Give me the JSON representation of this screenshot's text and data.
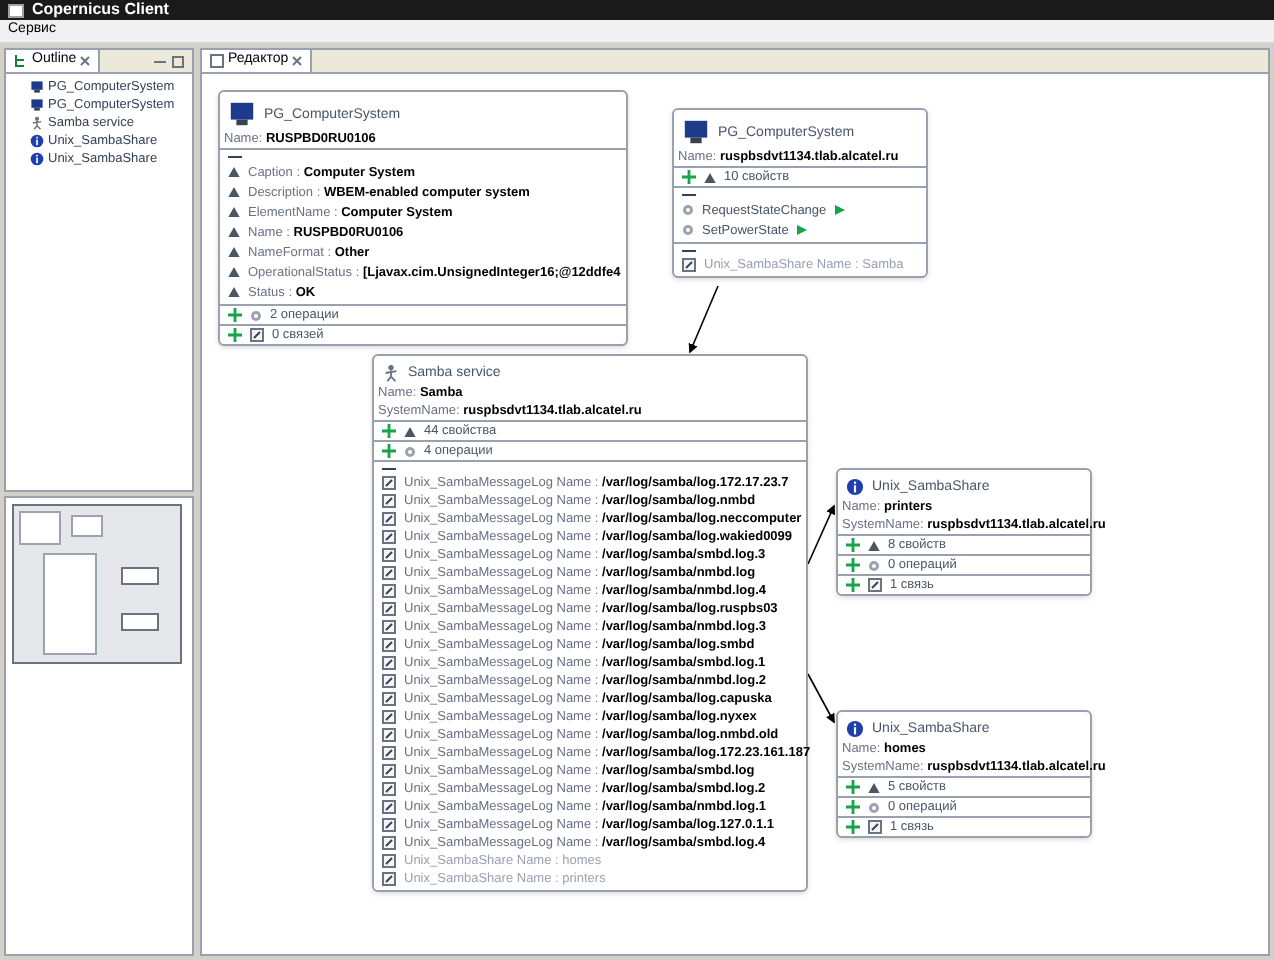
{
  "window": {
    "title": "Copernicus Client"
  },
  "menu": [
    "Сервис"
  ],
  "outline": {
    "tab": "Outline",
    "items": [
      {
        "kind": "computer",
        "label": "PG_ComputerSystem"
      },
      {
        "kind": "computer",
        "label": "PG_ComputerSystem"
      },
      {
        "kind": "service",
        "label": "Samba service"
      },
      {
        "kind": "share",
        "label": "Unix_SambaShare"
      },
      {
        "kind": "share",
        "label": "Unix_SambaShare"
      }
    ]
  },
  "editor": {
    "tab": "Редактор"
  },
  "nodes": [
    {
      "kind": "computer",
      "title": "PG_ComputerSystem",
      "fields": [
        {
          "label": "Name:",
          "value": "RUSPBD0RU0106"
        }
      ],
      "sections": [
        {
          "kind": "properties",
          "expanded": true,
          "items": [
            {
              "label": "Caption :",
              "value": "Computer System"
            },
            {
              "label": "Description :",
              "value": "WBEM-enabled computer system"
            },
            {
              "label": "ElementName :",
              "value": "Computer System"
            },
            {
              "label": "Name :",
              "value": "RUSPBD0RU0106"
            },
            {
              "label": "NameFormat :",
              "value": "Other"
            },
            {
              "label": "OperationalStatus :",
              "value": "[Ljavax.cim.UnsignedInteger16;@12ddfe4"
            },
            {
              "label": "Status :",
              "value": "OK"
            }
          ]
        },
        {
          "kind": "operations",
          "expanded": false,
          "label": "2 операции"
        },
        {
          "kind": "links",
          "expanded": false,
          "label": "0 связей"
        }
      ]
    },
    {
      "kind": "computer",
      "title": "PG_ComputerSystem",
      "fields": [
        {
          "label": "Name:",
          "value": "ruspbsdvt1134.tlab.alcatel.ru"
        }
      ],
      "sections": [
        {
          "kind": "properties",
          "expanded": false,
          "label": "10 свойств"
        },
        {
          "kind": "operations",
          "expanded": true,
          "items": [
            {
              "label": "RequestStateChange"
            },
            {
              "label": "SetPowerState"
            }
          ]
        },
        {
          "kind": "links",
          "expanded": true,
          "items": [
            {
              "type": "Unix_SambaShare",
              "label": "Name :",
              "value": "Samba",
              "faded": true
            }
          ]
        }
      ]
    },
    {
      "kind": "service",
      "title": "Samba service",
      "fields": [
        {
          "label": "Name:",
          "value": "Samba"
        },
        {
          "label": "SystemName:",
          "value": "ruspbsdvt1134.tlab.alcatel.ru"
        }
      ],
      "sections": [
        {
          "kind": "properties",
          "expanded": false,
          "label": "44 свойства"
        },
        {
          "kind": "operations",
          "expanded": false,
          "label": "4 операции"
        },
        {
          "kind": "links",
          "expanded": true,
          "items": [
            {
              "type": "Unix_SambaMessageLog",
              "label": "Name :",
              "value": "/var/log/samba/log.172.17.23.7",
              "faded": false
            },
            {
              "type": "Unix_SambaMessageLog",
              "label": "Name :",
              "value": "/var/log/samba/log.nmbd",
              "faded": false
            },
            {
              "type": "Unix_SambaMessageLog",
              "label": "Name :",
              "value": "/var/log/samba/log.neccomputer",
              "faded": false
            },
            {
              "type": "Unix_SambaMessageLog",
              "label": "Name :",
              "value": "/var/log/samba/log.wakied0099",
              "faded": false
            },
            {
              "type": "Unix_SambaMessageLog",
              "label": "Name :",
              "value": "/var/log/samba/smbd.log.3",
              "faded": false
            },
            {
              "type": "Unix_SambaMessageLog",
              "label": "Name :",
              "value": "/var/log/samba/nmbd.log",
              "faded": false
            },
            {
              "type": "Unix_SambaMessageLog",
              "label": "Name :",
              "value": "/var/log/samba/nmbd.log.4",
              "faded": false
            },
            {
              "type": "Unix_SambaMessageLog",
              "label": "Name :",
              "value": "/var/log/samba/log.ruspbs03",
              "faded": false
            },
            {
              "type": "Unix_SambaMessageLog",
              "label": "Name :",
              "value": "/var/log/samba/nmbd.log.3",
              "faded": false
            },
            {
              "type": "Unix_SambaMessageLog",
              "label": "Name :",
              "value": "/var/log/samba/log.smbd",
              "faded": false
            },
            {
              "type": "Unix_SambaMessageLog",
              "label": "Name :",
              "value": "/var/log/samba/smbd.log.1",
              "faded": false
            },
            {
              "type": "Unix_SambaMessageLog",
              "label": "Name :",
              "value": "/var/log/samba/nmbd.log.2",
              "faded": false
            },
            {
              "type": "Unix_SambaMessageLog",
              "label": "Name :",
              "value": "/var/log/samba/log.capuska",
              "faded": false
            },
            {
              "type": "Unix_SambaMessageLog",
              "label": "Name :",
              "value": "/var/log/samba/log.nyxex",
              "faded": false
            },
            {
              "type": "Unix_SambaMessageLog",
              "label": "Name :",
              "value": "/var/log/samba/log.nmbd.old",
              "faded": false
            },
            {
              "type": "Unix_SambaMessageLog",
              "label": "Name :",
              "value": "/var/log/samba/log.172.23.161.187",
              "faded": false
            },
            {
              "type": "Unix_SambaMessageLog",
              "label": "Name :",
              "value": "/var/log/samba/smbd.log",
              "faded": false
            },
            {
              "type": "Unix_SambaMessageLog",
              "label": "Name :",
              "value": "/var/log/samba/smbd.log.2",
              "faded": false
            },
            {
              "type": "Unix_SambaMessageLog",
              "label": "Name :",
              "value": "/var/log/samba/nmbd.log.1",
              "faded": false
            },
            {
              "type": "Unix_SambaMessageLog",
              "label": "Name :",
              "value": "/var/log/samba/log.127.0.1.1",
              "faded": false
            },
            {
              "type": "Unix_SambaMessageLog",
              "label": "Name :",
              "value": "/var/log/samba/smbd.log.4",
              "faded": false
            },
            {
              "type": "Unix_SambaShare",
              "label": "Name :",
              "value": "homes",
              "faded": true
            },
            {
              "type": "Unix_SambaShare",
              "label": "Name :",
              "value": "printers",
              "faded": true
            }
          ]
        }
      ]
    },
    {
      "kind": "share",
      "title": "Unix_SambaShare",
      "fields": [
        {
          "label": "Name:",
          "value": "printers"
        },
        {
          "label": "SystemName:",
          "value": "ruspbsdvt1134.tlab.alcatel.ru"
        }
      ],
      "sections": [
        {
          "kind": "properties",
          "expanded": false,
          "label": "8 свойств"
        },
        {
          "kind": "operations",
          "expanded": false,
          "label": "0 операций"
        },
        {
          "kind": "links",
          "expanded": false,
          "label": "1 связь"
        }
      ]
    },
    {
      "kind": "share",
      "title": "Unix_SambaShare",
      "fields": [
        {
          "label": "Name:",
          "value": "homes"
        },
        {
          "label": "SystemName:",
          "value": "ruspbsdvt1134.tlab.alcatel.ru"
        }
      ],
      "sections": [
        {
          "kind": "properties",
          "expanded": false,
          "label": "5 свойств"
        },
        {
          "kind": "operations",
          "expanded": false,
          "label": "0 операций"
        },
        {
          "kind": "links",
          "expanded": false,
          "label": "1 связь"
        }
      ]
    }
  ]
}
